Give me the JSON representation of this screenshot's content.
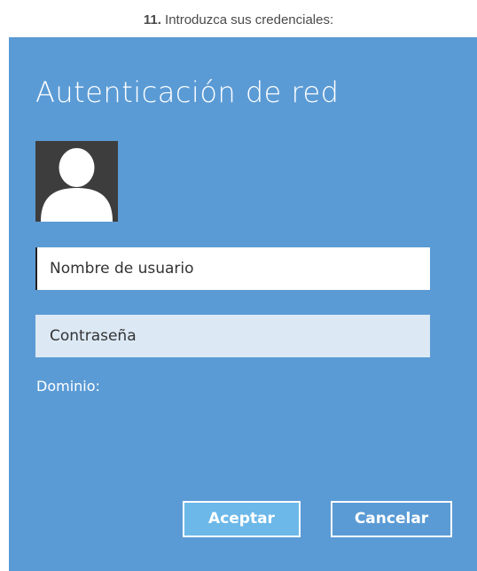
{
  "caption": {
    "step_number": "11.",
    "text": "Introduzca sus credenciales:"
  },
  "dialog": {
    "title": "Autenticación de red",
    "background_color": "#5b9bd5",
    "avatar_icon": "user-silhouette-icon",
    "username_field": {
      "placeholder": "Nombre de usuario",
      "value": ""
    },
    "password_field": {
      "placeholder": "Contraseña",
      "value": ""
    },
    "domain_label": "Dominio:",
    "buttons": {
      "accept_label": "Aceptar",
      "cancel_label": "Cancelar"
    }
  }
}
